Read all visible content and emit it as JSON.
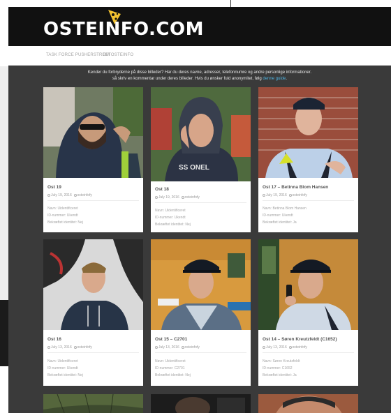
{
  "header": {
    "logo": "OSTEINFO.COM"
  },
  "nav": [
    {
      "label": "TASK FORCE PUSHERSTREET"
    },
    {
      "label": "OM OSTEINFO"
    }
  ],
  "intro": {
    "line1": "Kender du forbryderne på disse billeder? Har du deres navne, adresser, telefonnumre og andre personlige informationer.",
    "line2_start": "så skriv en kommentar under deres billeder. Hvis du ønsker fuld anonymitet, følg ",
    "link": "denne guide",
    "line2_end": "."
  },
  "cards": [
    {
      "title": "Ost 19",
      "date": "July 19, 2016",
      "author": "osteinfofy",
      "name": "Navn: Uidentificeret",
      "id": "ID-nummer: Ukendt",
      "confirmed": "Bekræftet identitet: Nej"
    },
    {
      "title": "Ost 18",
      "date": "July 19, 2016",
      "author": "osteinfofy",
      "name": "Navn: Uidentificeret",
      "id": "ID-nummer: Ukendt",
      "confirmed": "Bekræftet identitet: Nej"
    },
    {
      "title": "Ost 17 – Betinna Blom Hansen",
      "date": "July 19, 2016",
      "author": "osteinfofy",
      "name": "Navn: Betinna Blom Hansen",
      "id": "ID-nummer: Ukendt",
      "confirmed": "Bekræftet identitet: Ja"
    },
    {
      "title": "Ost 16",
      "date": "July 13, 2016",
      "author": "osteinfofy",
      "name": "Navn: Uidentificeret",
      "id": "ID-nummer: Ukendt",
      "confirmed": "Bekræftet identitet: Nej"
    },
    {
      "title": "Ost 15 – C2701",
      "date": "July 13, 2016",
      "author": "osteinfofy",
      "name": "Navn: Uidentificeret",
      "id": "ID-nummer: C2701",
      "confirmed": "Bekræftet identitet: Nej"
    },
    {
      "title": "Ost 14 – Søren Kreutzfeldt (C1652)",
      "date": "July 13, 2016",
      "author": "osteinfofy",
      "name": "Navn: Søren Kreutzfeldt",
      "id": "ID-nummer: C1652",
      "confirmed": "Bekræftet identitet: Ja"
    }
  ],
  "colors": {
    "header_bg": "#111111",
    "page_bg": "#3a3a3a",
    "link": "#4fb3e0",
    "cheese": "#f2c230"
  },
  "icons": {
    "logo": "cheese-icon",
    "date": "clock-icon",
    "author": "user-icon"
  }
}
